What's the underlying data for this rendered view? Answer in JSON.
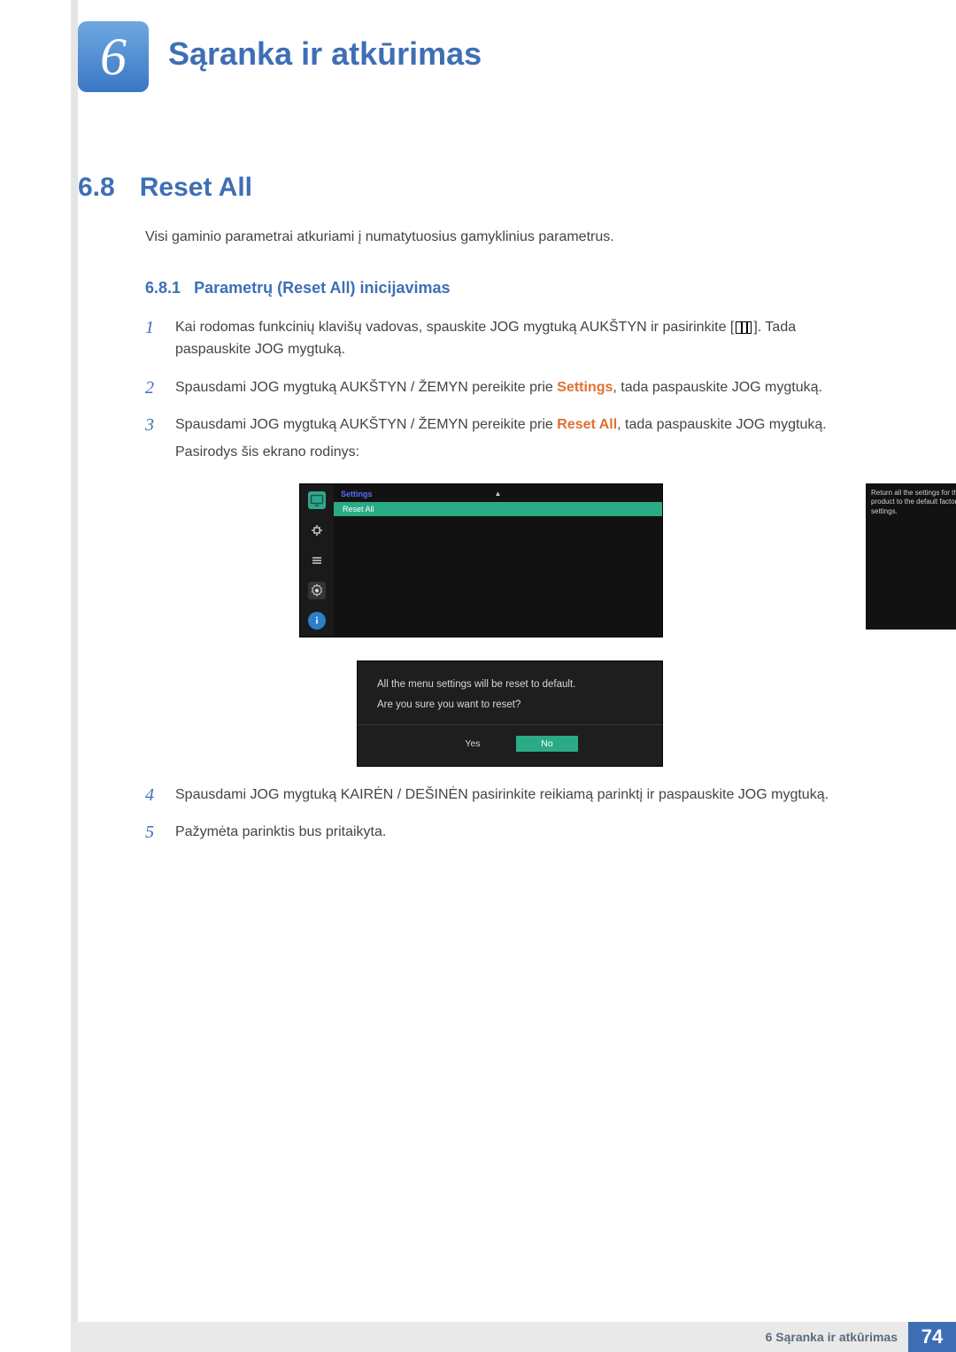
{
  "chapter": {
    "number": "6",
    "title": "Sąranka ir atkūrimas"
  },
  "section": {
    "number": "6.8",
    "title": "Reset All"
  },
  "intro": "Visi gaminio parametrai atkuriami į numatytuosius gamyklinius parametrus.",
  "subsection": {
    "number": "6.8.1",
    "title": "Parametrų (Reset All) inicijavimas"
  },
  "steps": {
    "s1a": "Kai rodomas funkcinių klavišų vadovas, spauskite JOG mygtuką AUKŠTYN ir pasirinkite [",
    "s1b": "]. Tada paspauskite JOG mygtuką.",
    "s2a": "Spausdami JOG mygtuką AUKŠTYN / ŽEMYN pereikite prie ",
    "s2_kw": "Settings",
    "s2b": ", tada paspauskite JOG mygtuką.",
    "s3a": "Spausdami JOG mygtuką AUKŠTYN / ŽEMYN pereikite prie ",
    "s3_kw": "Reset All",
    "s3b": ", tada paspauskite JOG mygtuką.",
    "s3_after": "Pasirodys šis ekrano rodinys:",
    "s4": "Spausdami JOG mygtuką KAIRĖN / DEŠINĖN pasirinkite reikiamą parinktį ir paspauskite JOG mygtuką.",
    "s5": "Pažymėta parinktis bus pritaikyta."
  },
  "nums": {
    "n1": "1",
    "n2": "2",
    "n3": "3",
    "n4": "4",
    "n5": "5"
  },
  "osd": {
    "title": "Settings",
    "item": "Reset All",
    "hint": "Return all the settings for the product to the default factory settings."
  },
  "dialog": {
    "line1": "All the menu settings will be reset to default.",
    "line2": "Are you sure you want to reset?",
    "yes": "Yes",
    "no": "No"
  },
  "footer": {
    "title": "6 Sąranka ir atkūrimas",
    "page": "74"
  }
}
